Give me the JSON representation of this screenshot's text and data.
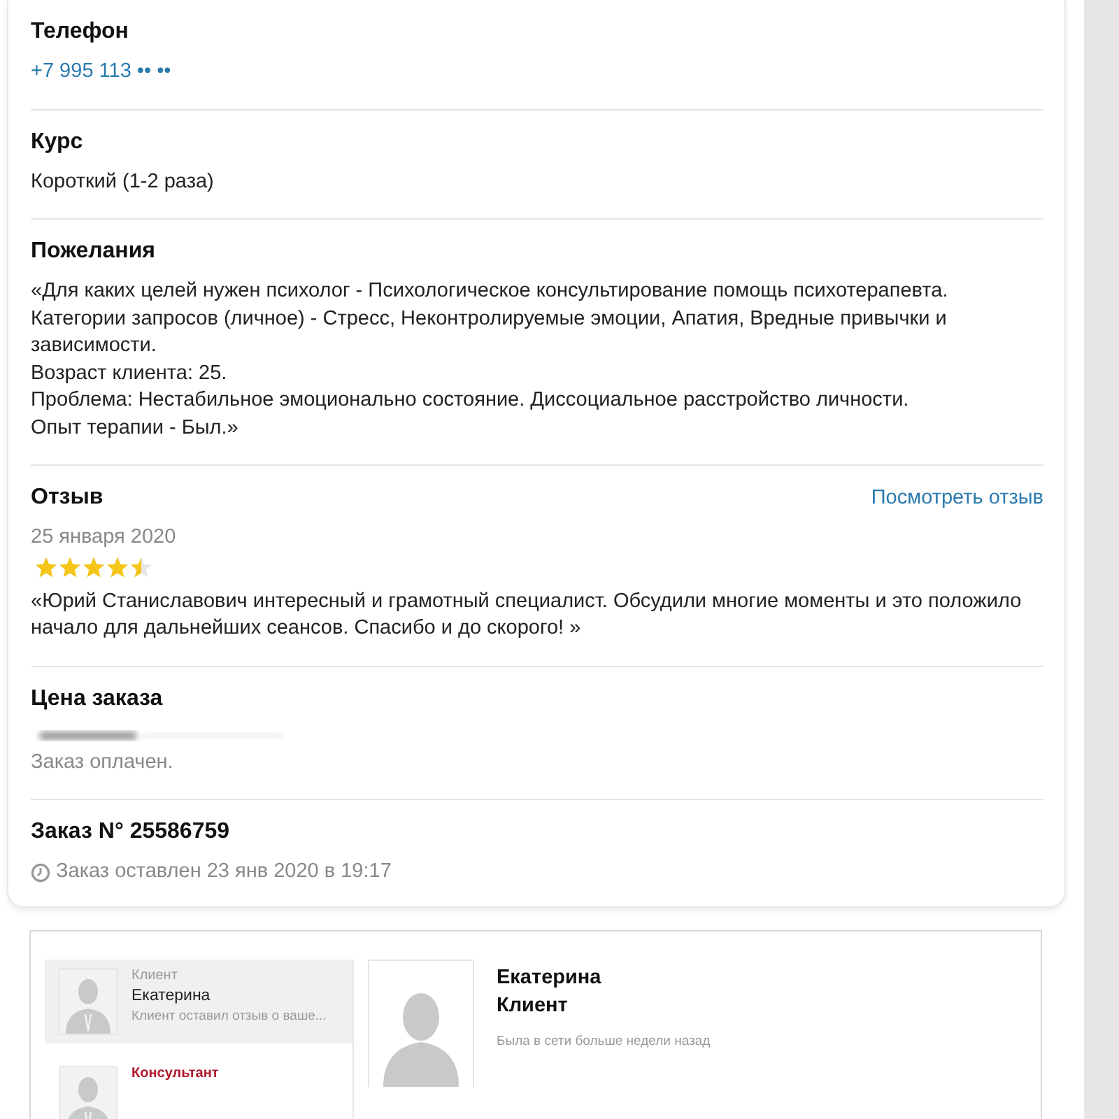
{
  "phone": {
    "title": "Телефон",
    "value": "+7 995 113 •• ••"
  },
  "course": {
    "title": "Курс",
    "value": "Короткий (1-2 раза)"
  },
  "wishes": {
    "title": "Пожелания",
    "lines": [
      "«Для каких целей нужен психолог - Психологическое консультирование помощь психотерапевта. Категории запросов (личное) - Стресс, Неконтролируемые эмоции, Апатия, Вредные привычки и зависимости.",
      "Возраст клиента: 25.",
      "Проблема: Нестабильное эмоционально состояние. Диссоциальное расстройство личности.",
      "Опыт терапии - Был.»"
    ]
  },
  "review": {
    "title": "Отзыв",
    "link": "Посмотреть отзыв",
    "date": "25 января 2020",
    "stars": 4.5,
    "text": "«Юрий Станиславович интересный и грамотный специалист. Обсудили многие моменты и это положило начало для дальнейших сеансов. Спасибо и до скорого! »"
  },
  "price": {
    "title": "Цена заказа",
    "status": "Заказ оплачен."
  },
  "order": {
    "title": "Заказ N° 25586759",
    "placed": "Заказ оставлен 23 янв 2020 в 19:17"
  },
  "chat": {
    "contacts": [
      {
        "role": "Клиент",
        "name": "Екатерина",
        "preview": "Клиент оставил отзыв о ваше...",
        "selected": true,
        "kind": "client"
      },
      {
        "role": "Консультант",
        "selected": false,
        "kind": "consultant"
      }
    ],
    "profile": {
      "name": "Екатерина",
      "role": "Клиент",
      "last_seen": "Была в сети больше недели назад"
    }
  }
}
